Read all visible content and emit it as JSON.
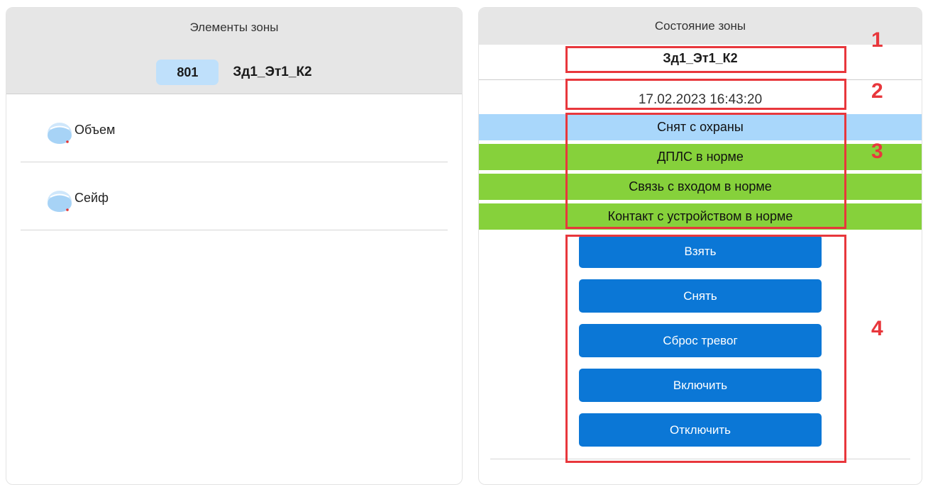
{
  "left": {
    "title": "Элементы зоны",
    "zone_number": "801",
    "zone_name": "Зд1_Эт1_К2",
    "elements": [
      {
        "label": "Объем",
        "icon": "detector-icon"
      },
      {
        "label": "Сейф",
        "icon": "detector-icon"
      }
    ]
  },
  "right": {
    "title": "Состояние зоны",
    "zone_name": "Зд1_Эт1_К2",
    "timestamp": "17.02.2023 16:43:20",
    "statuses": [
      {
        "text": "Снят с охраны",
        "color": "#a9d7fb"
      },
      {
        "text": "ДПЛС в норме",
        "color": "#86d13b"
      },
      {
        "text": "Связь с входом в норме",
        "color": "#86d13b"
      },
      {
        "text": "Контакт с устройством в норме",
        "color": "#86d13b"
      }
    ],
    "buttons": [
      "Взять",
      "Снять",
      "Сброс тревог",
      "Включить",
      "Отключить"
    ]
  },
  "annotations": [
    "1",
    "2",
    "3",
    "4"
  ],
  "colors": {
    "button_blue": "#0b77d6",
    "status_blue": "#a9d7fb",
    "status_green": "#86d13b",
    "marker_red": "#e8373c"
  }
}
